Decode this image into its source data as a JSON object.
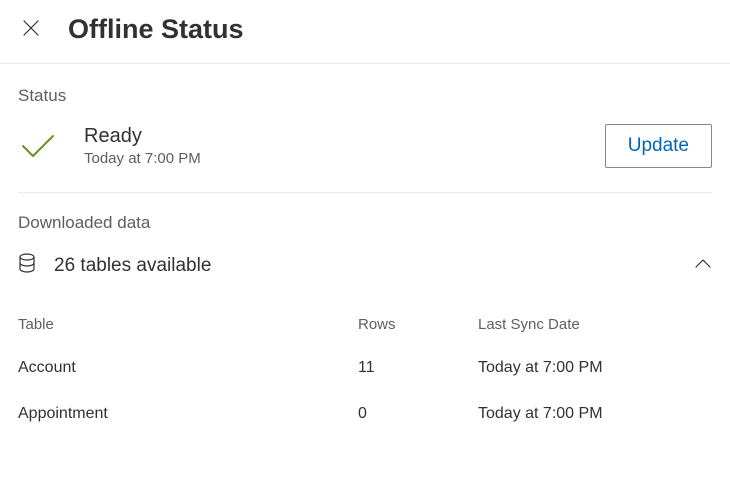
{
  "header": {
    "title": "Offline Status"
  },
  "status": {
    "section_label": "Status",
    "state": "Ready",
    "timestamp": "Today at 7:00 PM",
    "update_label": "Update"
  },
  "downloaded": {
    "section_label": "Downloaded data",
    "summary": "26 tables available",
    "columns": {
      "table": "Table",
      "rows": "Rows",
      "last_sync": "Last Sync Date"
    },
    "rows": [
      {
        "table": "Account",
        "rows": "11",
        "last_sync": "Today at 7:00 PM"
      },
      {
        "table": "Appointment",
        "rows": "0",
        "last_sync": "Today at 7:00 PM"
      }
    ]
  },
  "colors": {
    "link": "#0067b8",
    "check": "#6b8e23",
    "text_primary": "#323130",
    "text_secondary": "#605e5c",
    "border": "#edebe9"
  }
}
